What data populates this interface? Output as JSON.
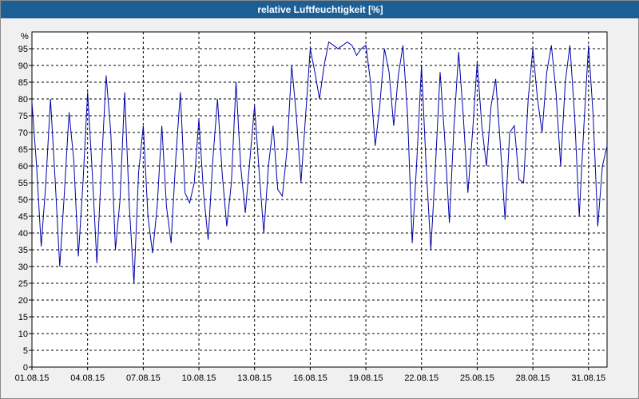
{
  "window": {
    "title": "relative Luftfeuchtigkeit [%]"
  },
  "chart_data": {
    "type": "line",
    "title": "relative Luftfeuchtigkeit [%]",
    "ylabel": "%",
    "xlabel": "",
    "ylim": [
      0,
      100
    ],
    "xlim": [
      "2015-08-01 00:00",
      "2015-09-01 00:00"
    ],
    "y_ticks": [
      0,
      5,
      10,
      15,
      20,
      25,
      30,
      35,
      40,
      45,
      50,
      55,
      60,
      65,
      70,
      75,
      80,
      85,
      90,
      95
    ],
    "x_ticks": [
      "01.08.15",
      "04.08.15",
      "07.08.15",
      "10.08.15",
      "13.08.15",
      "16.08.15",
      "19.08.15",
      "22.08.15",
      "25.08.15",
      "28.08.15",
      "31.08.15"
    ],
    "grid": true,
    "line_color": "#0000aa",
    "series": [
      {
        "x_start": "2015-08-01 00:00",
        "x_step_hours": 6,
        "values": [
          79,
          60,
          36,
          55,
          80,
          56,
          30,
          52,
          76,
          62,
          33,
          55,
          82,
          58,
          31,
          60,
          87,
          70,
          35,
          50,
          82,
          48,
          25,
          58,
          72,
          45,
          34,
          48,
          72,
          48,
          37,
          62,
          82,
          52,
          49,
          55,
          74,
          52,
          38,
          62,
          80,
          58,
          42,
          55,
          85,
          60,
          46,
          62,
          78,
          58,
          40,
          60,
          72,
          53,
          51,
          65,
          90,
          75,
          55,
          75,
          95,
          88,
          80,
          90,
          97,
          96,
          95,
          96,
          97,
          96,
          93,
          95,
          96,
          85,
          66,
          78,
          95,
          88,
          72,
          87,
          96,
          75,
          37,
          62,
          90,
          60,
          35,
          60,
          88,
          68,
          43,
          72,
          94,
          75,
          52,
          70,
          91,
          72,
          60,
          78,
          86,
          66,
          44,
          70,
          72,
          56,
          55,
          80,
          95,
          80,
          70,
          88,
          96,
          82,
          60,
          85,
          96,
          75,
          45,
          72,
          96,
          75,
          42,
          60,
          66
        ]
      }
    ]
  }
}
